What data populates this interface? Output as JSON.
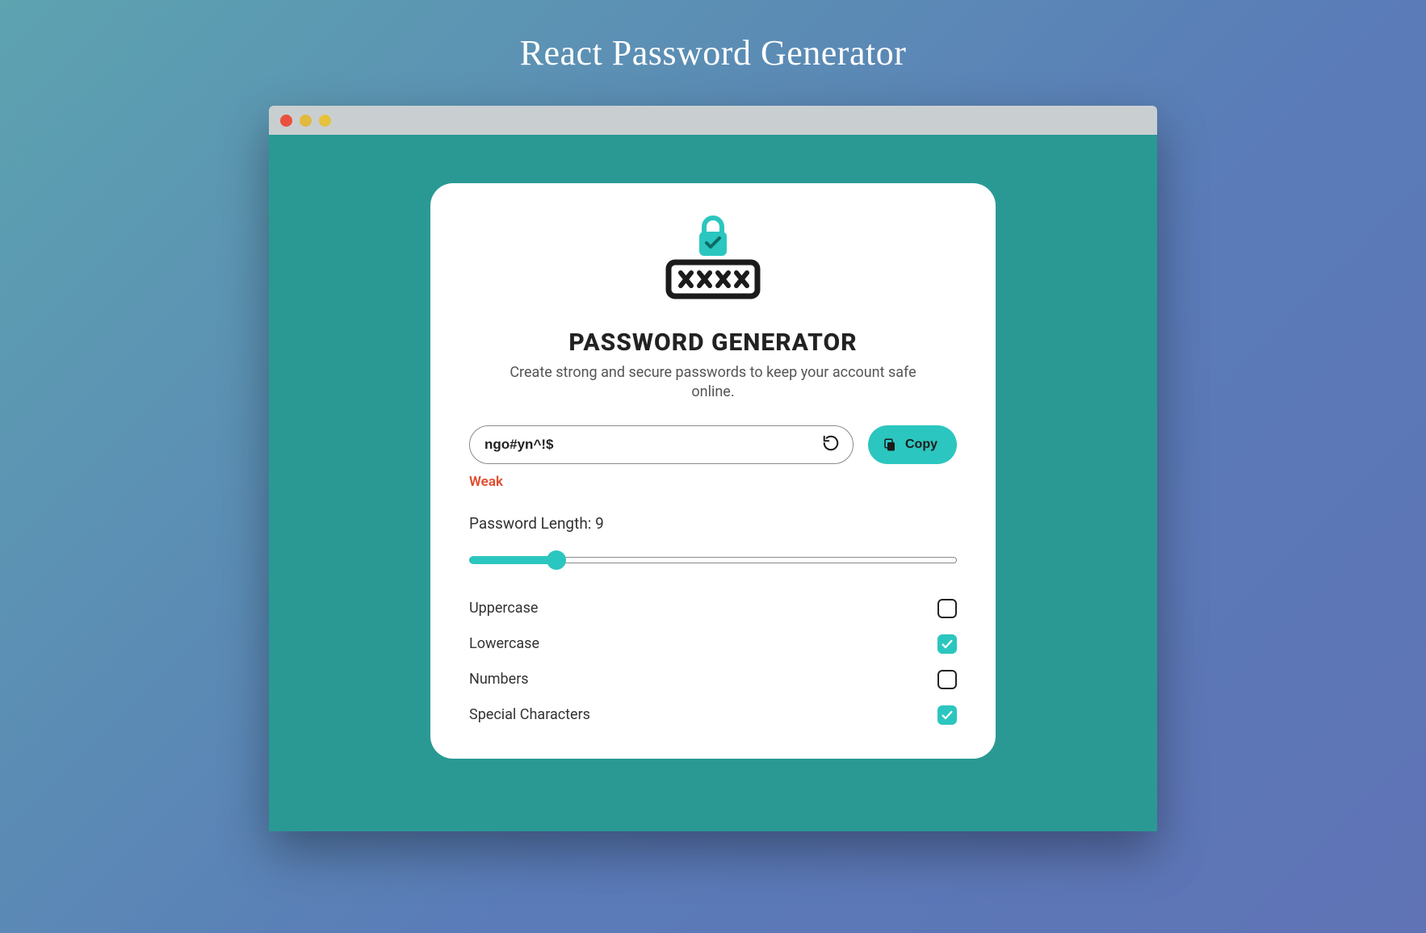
{
  "page": {
    "title": "React Password Generator"
  },
  "window": {
    "traffic": {
      "close": "#e9513e",
      "min": "#e0b93e",
      "max": "#e6c13d"
    }
  },
  "card": {
    "heading": "PASSWORD GENERATOR",
    "subtitle": "Create strong and secure passwords to keep your account safe online."
  },
  "password": {
    "value": "ngo#yn^!$",
    "strength_label": "Weak",
    "strength_color": "#e14b2e"
  },
  "copy": {
    "label": "Copy"
  },
  "length": {
    "label_prefix": "Password Length: ",
    "value": 9,
    "min": 4,
    "max": 32
  },
  "options": [
    {
      "key": "uppercase",
      "label": "Uppercase",
      "checked": false
    },
    {
      "key": "lowercase",
      "label": "Lowercase",
      "checked": true
    },
    {
      "key": "numbers",
      "label": "Numbers",
      "checked": false
    },
    {
      "key": "special",
      "label": "Special Characters",
      "checked": true
    }
  ],
  "colors": {
    "accent": "#2bc6bf",
    "app_bg": "#2a9994",
    "title_bar": "#c9cfd1"
  }
}
